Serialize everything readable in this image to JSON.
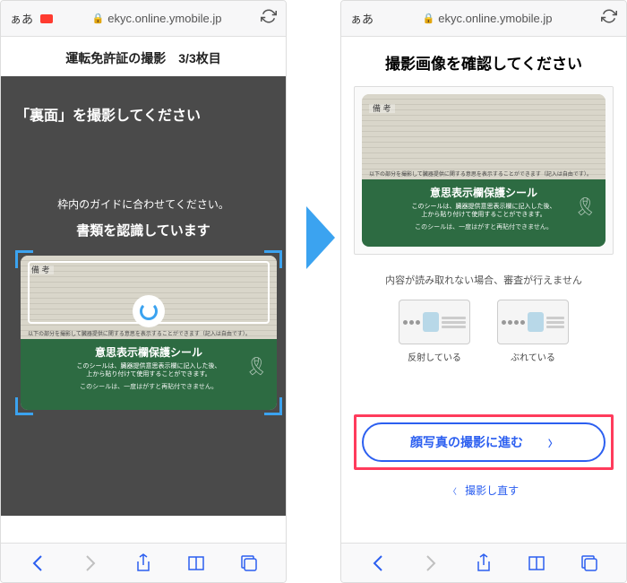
{
  "left": {
    "browser": {
      "aa": "ぁあ",
      "url": "ekyc.online.ymobile.jp"
    },
    "pageTitle": "運転免許証の撮影　3/3枚目",
    "instruction1": "「裏面」を撮影してください",
    "instruction2": "枠内のガイドに合わせてください。",
    "instruction3": "書類を認識しています",
    "card": {
      "biko": "備 考",
      "smallLine": "以下の部分を撮影して臓器提供に関する意思を表示することができます（記入は自由です）。",
      "greenTitle": "意思表示欄保護シール",
      "greenText1": "このシールは、臓器提供意思表示欄に記入した後、",
      "greenText2": "上から貼り付けて使用することができます。",
      "greenFoot": "このシールは、一度はがすと再貼付できません。"
    }
  },
  "right": {
    "browser": {
      "aa": "ぁあ",
      "url": "ekyc.online.ymobile.jp"
    },
    "title": "撮影画像を確認してください",
    "warnText": "内容が読み取れない場合、審査が行えません",
    "example1": "反射している",
    "example2": "ぶれている",
    "primaryBtn": "顔写真の撮影に進む",
    "retake": "撮影し直す"
  }
}
